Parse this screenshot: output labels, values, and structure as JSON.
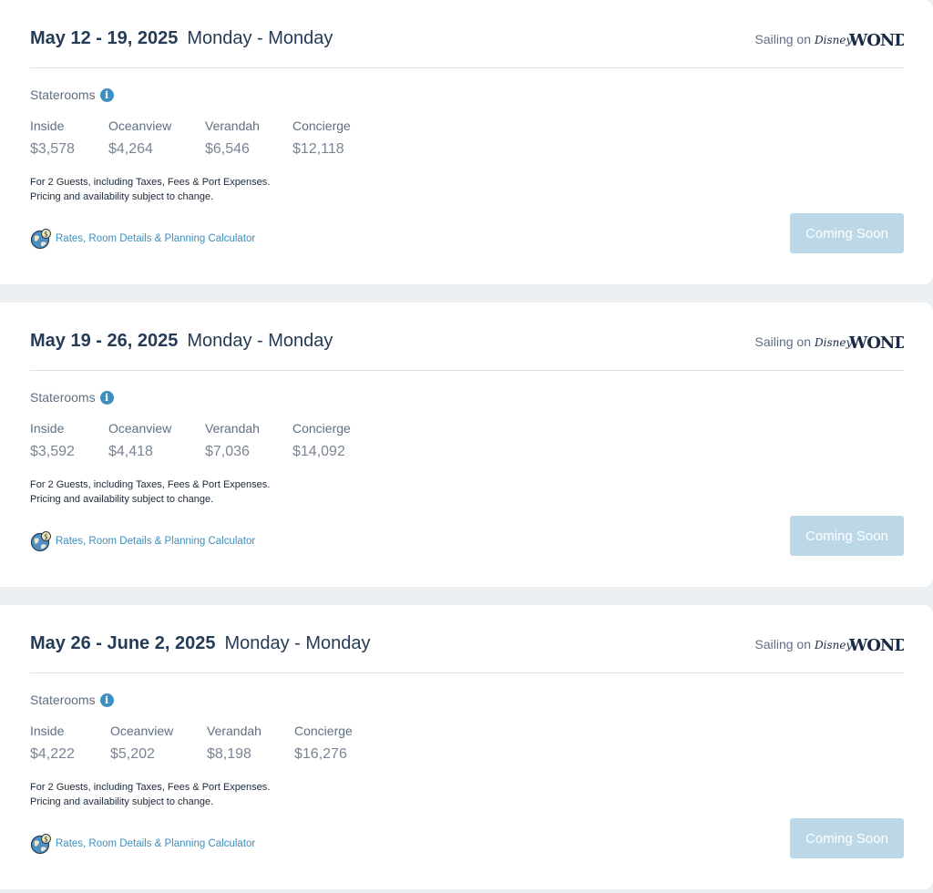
{
  "common": {
    "sailing_on": "Sailing on",
    "ship_logo_text": "Disney WONDER",
    "staterooms_label": "Staterooms",
    "info_glyph": "i",
    "note_line1": "For 2 Guests, including Taxes, Fees & Port Expenses.",
    "note_line2": "Pricing and availability subject to change.",
    "rates_link": "Rates, Room Details & Planning Calculator",
    "coming_soon": "Coming Soon",
    "accent_color": "#3d8fbd",
    "button_color": "#bcd8e7"
  },
  "sailings": [
    {
      "dates": "May 12 - 19, 2025",
      "days": "Monday - Monday",
      "prices": [
        {
          "type": "Inside",
          "value": "$3,578"
        },
        {
          "type": "Oceanview",
          "value": "$4,264"
        },
        {
          "type": "Verandah",
          "value": "$6,546"
        },
        {
          "type": "Concierge",
          "value": "$12,118"
        }
      ]
    },
    {
      "dates": "May 19 - 26, 2025",
      "days": "Monday - Monday",
      "prices": [
        {
          "type": "Inside",
          "value": "$3,592"
        },
        {
          "type": "Oceanview",
          "value": "$4,418"
        },
        {
          "type": "Verandah",
          "value": "$7,036"
        },
        {
          "type": "Concierge",
          "value": "$14,092"
        }
      ]
    },
    {
      "dates": "May 26 - June 2, 2025",
      "days": "Monday - Monday",
      "prices": [
        {
          "type": "Inside",
          "value": "$4,222"
        },
        {
          "type": "Oceanview",
          "value": "$5,202"
        },
        {
          "type": "Verandah",
          "value": "$8,198"
        },
        {
          "type": "Concierge",
          "value": "$16,276"
        }
      ]
    }
  ]
}
